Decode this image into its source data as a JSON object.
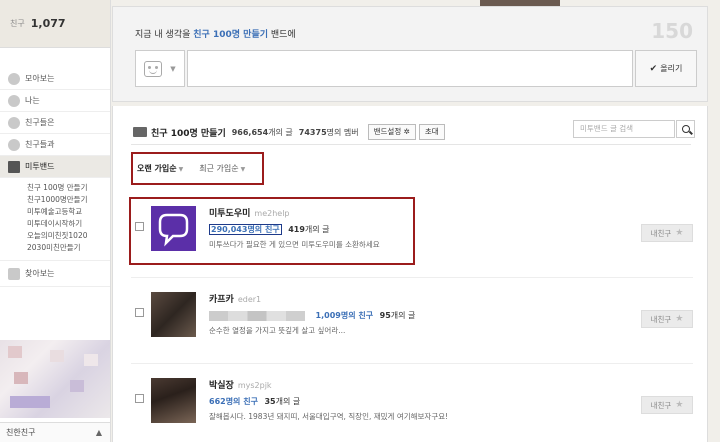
{
  "sidebar": {
    "friends_label": "친구",
    "friends_count": "1,077",
    "nav": [
      {
        "label": "모아보는",
        "icon": "feed-icon"
      },
      {
        "label": "나는",
        "icon": "me-icon"
      },
      {
        "label": "친구들은",
        "icon": "friends-icon"
      },
      {
        "label": "친구들과",
        "icon": "chat-icon"
      },
      {
        "label": "미투밴드",
        "icon": "band-icon"
      }
    ],
    "bands": [
      "친구 100명 만들기",
      "친구1000명만들기",
      "미투예술고등학교",
      "미투데이시작하기",
      "오늘의미친짓1020",
      "2030미친만들기"
    ],
    "find_label": "찾아보는",
    "bottom_label": "친한친구",
    "bottom_caret": "▲"
  },
  "compose": {
    "title_prefix": "지금 내 생각을 ",
    "title_band": "친구 100명 만들기",
    "title_suffix": " 밴드에",
    "counter": "150",
    "emo_caret": "▼",
    "post_check": "✔",
    "post_label": "올리기"
  },
  "band": {
    "name": "친구 100명 만들기",
    "posts": "966,654",
    "posts_suffix": "개의 글",
    "members": "74375",
    "members_suffix": "명의 멤버",
    "settings_label": "밴드설정 ✲",
    "invite_label": "초대",
    "search_placeholder": "미투밴드 글 검색"
  },
  "sort": {
    "option1": "오랜 가입순",
    "option2": "최근 가입순",
    "caret": "▼"
  },
  "members": [
    {
      "name": "미투도우미",
      "id": "me2help",
      "friends": "290,043명의 친구",
      "posts": "419",
      "posts_suffix": "개의 글",
      "desc": "미투쓰다가 필요한 게 있으면 미투도우미를 소환하세요",
      "button": "내친구",
      "star": "★"
    },
    {
      "name": "카프카",
      "id": "eder1",
      "friends": "1,009명의 친구",
      "posts": "95",
      "posts_suffix": "개의 글",
      "desc": "순수한 열정을 가지고 뜻깊게 살고 싶어라...",
      "button": "내친구",
      "star": "★"
    },
    {
      "name": "박실장",
      "id": "mys2pjk",
      "friends": "662명의 친구",
      "posts": "35",
      "posts_suffix": "개의 글",
      "desc": "잘해봅시다. 1983년 돼지띠, 서울대입구역, 직장인, 재밌게 여기해보자구요!",
      "button": "내친구",
      "star": "★"
    }
  ]
}
